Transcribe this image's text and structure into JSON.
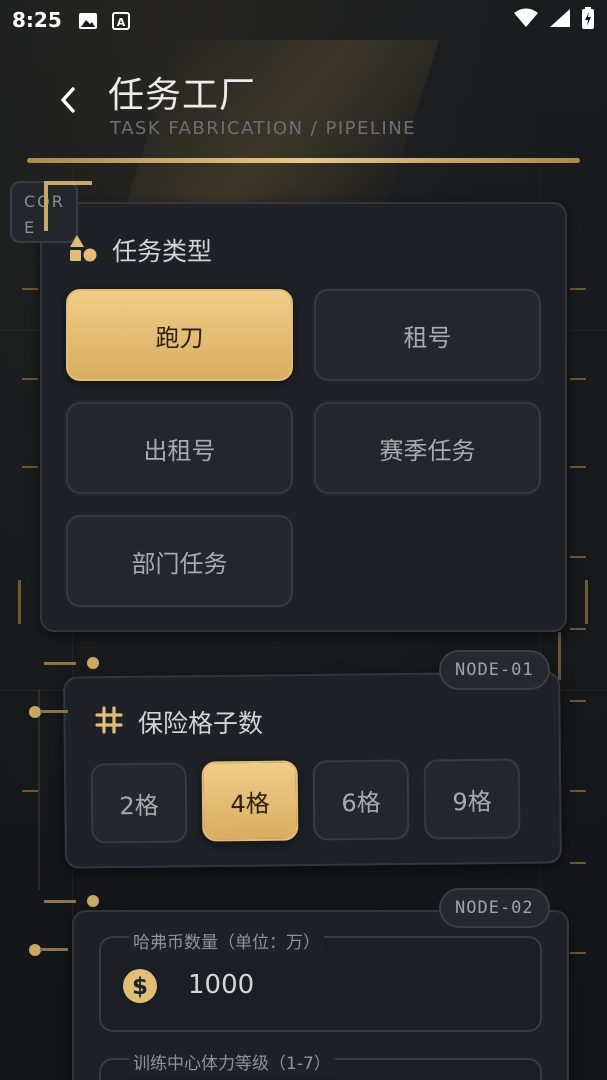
{
  "status_bar": {
    "time": "8:25",
    "icons": [
      "image-icon",
      "text-a-icon",
      "wifi-icon",
      "signal-icon",
      "battery-icon"
    ]
  },
  "header": {
    "title": "任务工厂",
    "subtitle": "TASK FABRICATION / PIPELINE"
  },
  "core_tag": "CORE",
  "task_type": {
    "label": "任务类型",
    "options": [
      {
        "label": "跑刀",
        "active": true
      },
      {
        "label": "租号",
        "active": false
      },
      {
        "label": "出租号",
        "active": false
      },
      {
        "label": "赛季任务",
        "active": false
      },
      {
        "label": "部门任务",
        "active": false
      }
    ]
  },
  "node1": {
    "tag": "NODE-01",
    "label": "保险格子数",
    "options": [
      {
        "label": "2格",
        "active": false
      },
      {
        "label": "4格",
        "active": true
      },
      {
        "label": "6格",
        "active": false
      },
      {
        "label": "9格",
        "active": false
      }
    ]
  },
  "node2": {
    "tag": "NODE-02",
    "coin_field": {
      "label": "哈弗币数量（单位：万）",
      "value": "1000"
    },
    "stamina_field": {
      "label": "训练中心体力等级（1-7）"
    }
  },
  "colors": {
    "accent_gold": "#e2bd78",
    "background": "#15181c",
    "panel": "#1e2125"
  }
}
